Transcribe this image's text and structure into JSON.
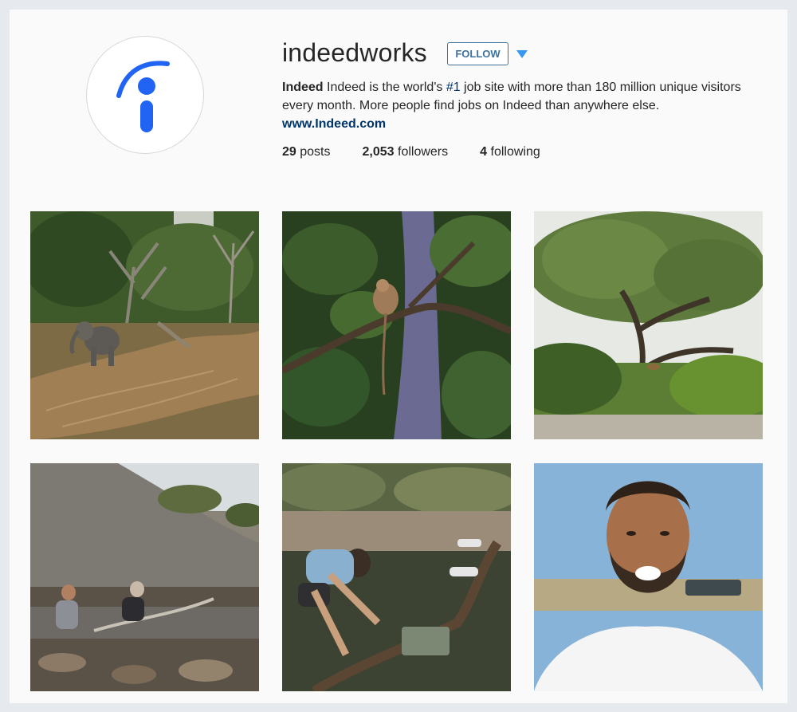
{
  "profile": {
    "username": "indeedworks",
    "follow_label": "FOLLOW",
    "bio": {
      "name": "Indeed",
      "text_before": " Indeed is the world's ",
      "hashtag": "#1",
      "text_after": " job site with more than 180 million unique visitors every month. More people find jobs on Indeed than anywhere else.",
      "link": "www.Indeed.com"
    },
    "stats": {
      "posts_count": "29",
      "posts_label": "posts",
      "followers_count": "2,053",
      "followers_label": "followers",
      "following_count": "4",
      "following_label": "following"
    }
  },
  "colors": {
    "brand_blue": "#2164f3",
    "link_blue": "#003569",
    "button_blue": "#3f729b"
  },
  "posts": [
    {
      "subject": "elephant-by-stream"
    },
    {
      "subject": "monkey-in-tree"
    },
    {
      "subject": "acacia-tree-with-leopard"
    },
    {
      "subject": "men-at-rocky-pond"
    },
    {
      "subject": "man-with-camera-trap"
    },
    {
      "subject": "bearded-man-selfie"
    }
  ]
}
